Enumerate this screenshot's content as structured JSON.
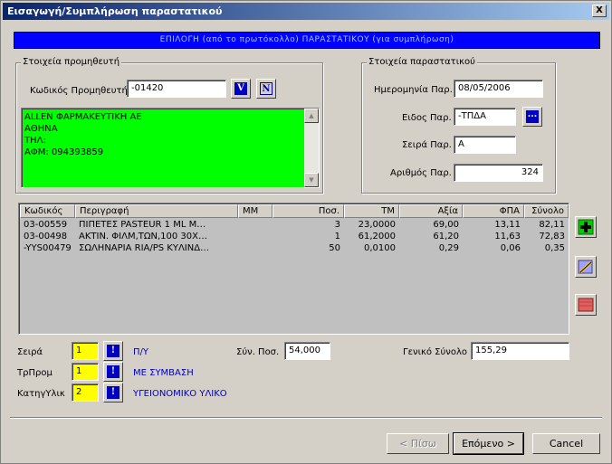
{
  "window": {
    "title": "Εισαγωγή/Συμπλήρωση παραστατικού",
    "close_label": "X"
  },
  "banner": {
    "text": "ΕΠΙΛΟΓΗ (από το πρωτόκολλο) ΠΑΡΑΣΤΑΤΙΚΟΥ (για συμπλήρωση)"
  },
  "supplier": {
    "group_label": "Στοιχεία προμηθευτή",
    "code_label": "Κωδικός Προμηθευτή",
    "code_value": "-01420",
    "btn1_label": "V",
    "btn2_label": "N",
    "info_lines": [
      "ALLEN ΦΑΡΜΑΚΕΥΤΙΚΗ ΑΕ",
      "ΑΘΗΝΑ",
      "ΤΗΛ:",
      "ΑΦΜ: 094393859"
    ]
  },
  "document": {
    "group_label": "Στοιχεία παραστατικού",
    "date_label": "Ημερομηνία Παρ.",
    "date_value": "08/05/2006",
    "type_label": "Ειδος Παρ.",
    "type_value": "-ΤΠΔΑ",
    "type_button": "...",
    "series_label": "Σειρά Παρ.",
    "series_value": "Α",
    "number_label": "Αριθμός Παρ.",
    "number_value": "324"
  },
  "grid": {
    "columns": [
      "Κωδικός",
      "Περιγραφή",
      "ΜΜ",
      "Ποσ.",
      "ΤΜ",
      "Αξία",
      "ΦΠΑ",
      "Σύνολο"
    ],
    "rows": [
      [
        "03-00559",
        "ΠΙΠΕΤΕΣ PASTEUR 1 ML M…",
        "",
        "3",
        "23,0000",
        "69,00",
        "13,11",
        "82,11"
      ],
      [
        "03-00498",
        "ΑΚΤΙΝ. ΦΙΛΜ,ΤΩΝ,100 30Χ…",
        "",
        "1",
        "61,2000",
        "61,20",
        "11,63",
        "72,83"
      ],
      [
        "-YYS00479",
        "ΣΩΛΗΝΑΡΙΑ RIA/PS ΚΥΛΙΝΔ…",
        "",
        "50",
        "0,0100",
        "0,29",
        "0,06",
        "0,35"
      ]
    ]
  },
  "side_buttons": {
    "add_icon": "plus-icon",
    "edit_icon": "edit-icon",
    "delete_icon": "delete-icon"
  },
  "bottom": {
    "seira_label": "Σειρά",
    "seira_value": "1",
    "seira_desc": "Π/Υ",
    "trprom_label": "ΤρΠρομ",
    "trprom_value": "1",
    "trprom_desc": "ΜΕ ΣΥΜΒΑΣΗ",
    "kathgyl_label": "ΚατηγΥλικ",
    "kathgyl_value": "2",
    "kathgyl_desc": "ΥΓΕΙΟΝΟΜΙΚΟ ΥΛΙΚΟ",
    "btn_label": "!",
    "total_qty_label": "Σύν. Ποσ.",
    "total_qty_value": "54,000",
    "grand_total_label": "Γενικό Σύνολο",
    "grand_total_value": "155,29"
  },
  "footer": {
    "back_label": "< Πίσω",
    "next_label": "Επόμενο >",
    "cancel_label": "Cancel"
  },
  "colors": {
    "banner_bg": "#0000ff",
    "supplier_info_bg": "#00ff00",
    "code_field_bg": "#ffff00"
  }
}
